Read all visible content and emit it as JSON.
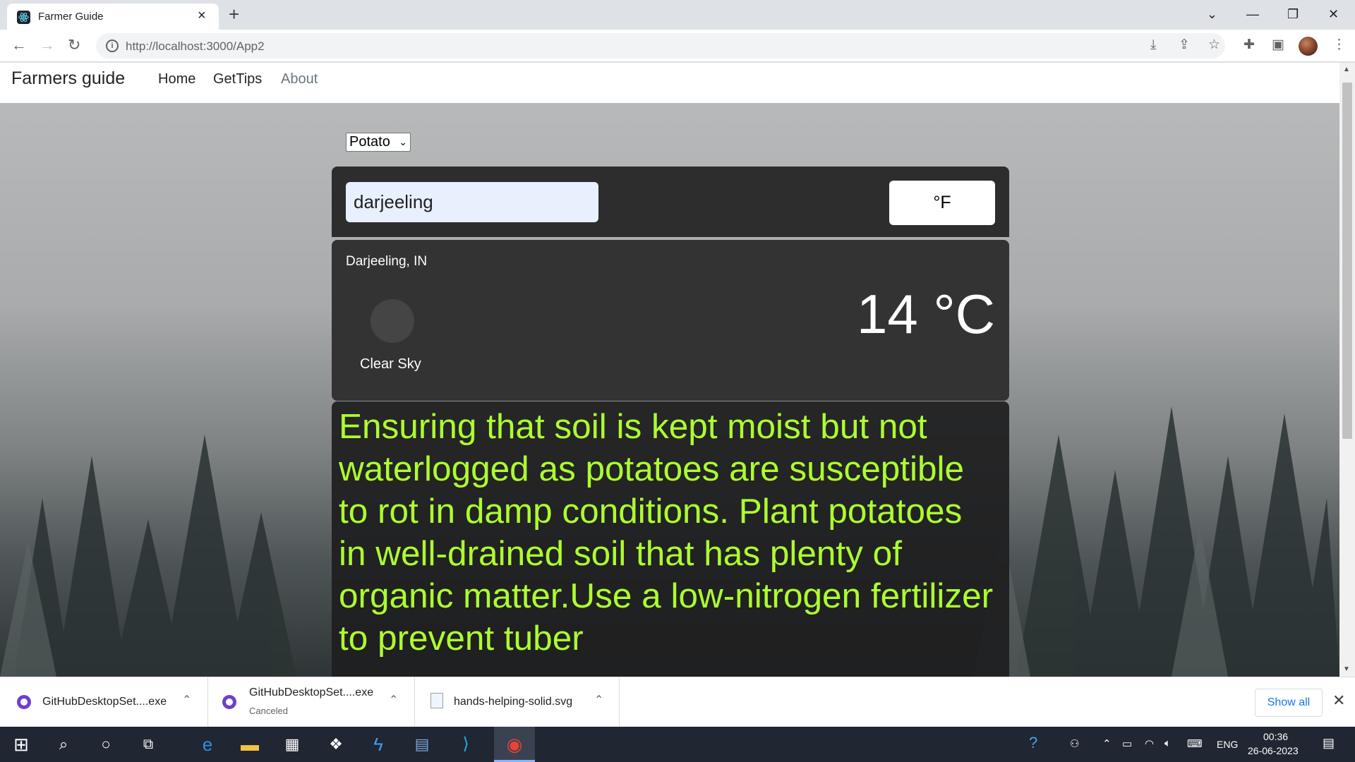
{
  "browser": {
    "tab_title": "Farmer Guide",
    "tab_close": "×",
    "new_tab": "+",
    "url": "http://localhost:3000/App2",
    "window_controls": [
      "⌄",
      "—",
      "❐",
      "✕"
    ]
  },
  "navbar": {
    "brand": "Farmers guide",
    "links": [
      "Home",
      "GetTips",
      "About"
    ]
  },
  "crop_select": {
    "value": "Potato"
  },
  "weather": {
    "city_input": "darjeeling",
    "unit_toggle": "°F",
    "location": "Darjeeling, IN",
    "condition": "Clear Sky",
    "temperature": "14 °C"
  },
  "tips": {
    "text": "Ensuring that soil is kept moist but not waterlogged as potatoes are susceptible to rot in damp conditions. Plant potatoes in well-drained soil that has plenty of organic matter.Use a low-nitrogen fertilizer to prevent tuber"
  },
  "downloads": {
    "items": [
      {
        "file": "GitHubDesktopSet....exe",
        "status": ""
      },
      {
        "file": "GitHubDesktopSet....exe",
        "status": "Canceled"
      },
      {
        "file": "hands-helping-solid.svg",
        "status": ""
      }
    ],
    "show_all": "Show all"
  },
  "taskbar": {
    "language": "ENG",
    "time": "00:36",
    "date": "26-06-2023"
  }
}
